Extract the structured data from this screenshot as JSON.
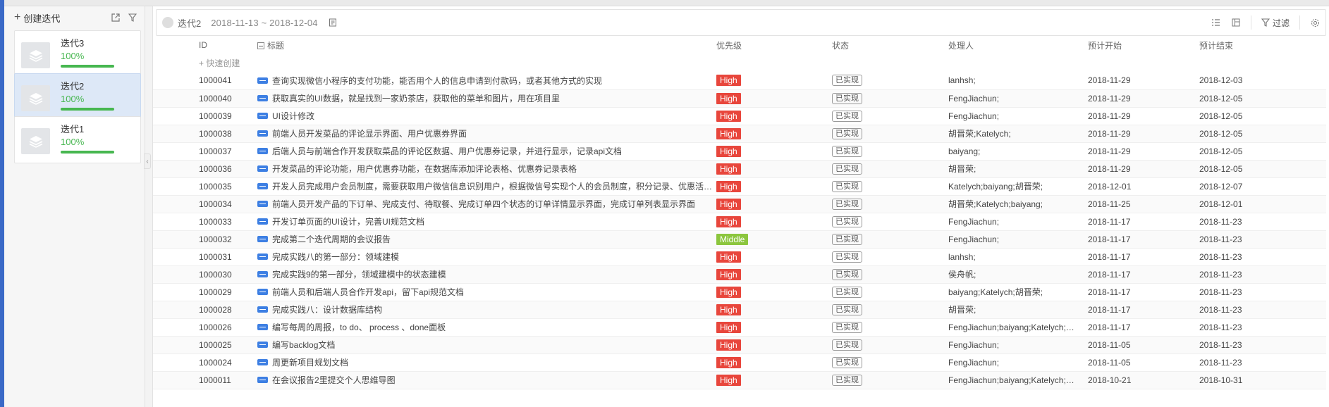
{
  "sidebar": {
    "add_label": "创建迭代",
    "iterations": [
      {
        "name": "迭代3",
        "progress_text": "100%",
        "progress": 1.0,
        "active": false
      },
      {
        "name": "迭代2",
        "progress_text": "100%",
        "progress": 1.0,
        "active": true
      },
      {
        "name": "迭代1",
        "progress_text": "100%",
        "progress": 1.0,
        "active": false
      }
    ]
  },
  "toolbar": {
    "iteration_name": "迭代2",
    "date_range": "2018-11-13 ~ 2018-12-04",
    "filter_label": "过滤"
  },
  "table": {
    "columns": {
      "id": "ID",
      "title": "标题",
      "priority": "优先级",
      "status": "状态",
      "assignee": "处理人",
      "start": "预计开始",
      "end": "预计结束"
    },
    "quick_create": "+ 快速创建",
    "rows": [
      {
        "id": "1000041",
        "title": "查询实现微信小程序的支付功能，能否用个人的信息申请到付款码，或者其他方式的实现",
        "priority": "High",
        "status": "已实现",
        "assignee": "lanhsh;",
        "start": "2018-11-29",
        "end": "2018-12-03"
      },
      {
        "id": "1000040",
        "title": "获取真实的UI数据，就是找到一家奶茶店，获取他的菜单和图片，用在项目里",
        "priority": "High",
        "status": "已实现",
        "assignee": "FengJiachun;",
        "start": "2018-11-29",
        "end": "2018-12-05"
      },
      {
        "id": "1000039",
        "title": "UI设计修改",
        "priority": "High",
        "status": "已实现",
        "assignee": "FengJiachun;",
        "start": "2018-11-29",
        "end": "2018-12-05"
      },
      {
        "id": "1000038",
        "title": "前端人员开发菜品的评论显示界面、用户优惠券界面",
        "priority": "High",
        "status": "已实现",
        "assignee": "胡晋荣;Katelych;",
        "start": "2018-11-29",
        "end": "2018-12-05"
      },
      {
        "id": "1000037",
        "title": "后端人员与前端合作开发获取菜品的评论区数据、用户优惠券记录，并进行显示，记录api文档",
        "priority": "High",
        "status": "已实现",
        "assignee": "baiyang;",
        "start": "2018-11-29",
        "end": "2018-12-05"
      },
      {
        "id": "1000036",
        "title": "开发菜品的评论功能，用户优惠券功能，在数据库添加评论表格、优惠券记录表格",
        "priority": "High",
        "status": "已实现",
        "assignee": "胡晋荣;",
        "start": "2018-11-29",
        "end": "2018-12-05"
      },
      {
        "id": "1000035",
        "title": "开发人员完成用户会员制度，需要获取用户微信信息识别用户，根据微信号实现个人的会员制度，积分记录、优惠活动…",
        "priority": "High",
        "status": "已实现",
        "assignee": "Katelych;baiyang;胡晋荣;",
        "start": "2018-12-01",
        "end": "2018-12-07"
      },
      {
        "id": "1000034",
        "title": "前端人员开发产品的下订单、完成支付、待取餐、完成订单四个状态的订单详情显示界面，完成订单列表显示界面",
        "priority": "High",
        "status": "已实现",
        "assignee": "胡晋荣;Katelych;baiyang;",
        "start": "2018-11-25",
        "end": "2018-12-01"
      },
      {
        "id": "1000033",
        "title": "开发订单页面的UI设计，完善UI规范文档",
        "priority": "High",
        "status": "已实现",
        "assignee": "FengJiachun;",
        "start": "2018-11-17",
        "end": "2018-11-23"
      },
      {
        "id": "1000032",
        "title": "完成第二个迭代周期的会议报告",
        "priority": "Middle",
        "status": "已实现",
        "assignee": "FengJiachun;",
        "start": "2018-11-17",
        "end": "2018-11-23"
      },
      {
        "id": "1000031",
        "title": "完成实践八的第一部分：领域建模",
        "priority": "High",
        "status": "已实现",
        "assignee": "lanhsh;",
        "start": "2018-11-17",
        "end": "2018-11-23"
      },
      {
        "id": "1000030",
        "title": "完成实践9的第一部分，领域建模中的状态建模",
        "priority": "High",
        "status": "已实现",
        "assignee": "侯舟帆;",
        "start": "2018-11-17",
        "end": "2018-11-23"
      },
      {
        "id": "1000029",
        "title": "前端人员和后端人员合作开发api，留下api规范文档",
        "priority": "High",
        "status": "已实现",
        "assignee": "baiyang;Katelych;胡晋荣;",
        "start": "2018-11-17",
        "end": "2018-11-23"
      },
      {
        "id": "1000028",
        "title": "完成实践八：设计数据库结构",
        "priority": "High",
        "status": "已实现",
        "assignee": "胡晋荣;",
        "start": "2018-11-17",
        "end": "2018-11-23"
      },
      {
        "id": "1000026",
        "title": "编写每周的周报，to do、 process 、done面板",
        "priority": "High",
        "status": "已实现",
        "assignee": "FengJiachun;baiyang;Katelych;…",
        "start": "2018-11-17",
        "end": "2018-11-23"
      },
      {
        "id": "1000025",
        "title": "编写backlog文档",
        "priority": "High",
        "status": "已实现",
        "assignee": "FengJiachun;",
        "start": "2018-11-05",
        "end": "2018-11-23"
      },
      {
        "id": "1000024",
        "title": "周更新项目规划文档",
        "priority": "High",
        "status": "已实现",
        "assignee": "FengJiachun;",
        "start": "2018-11-05",
        "end": "2018-11-23"
      },
      {
        "id": "1000011",
        "title": "在会议报告2里提交个人思维导图",
        "priority": "High",
        "status": "已实现",
        "assignee": "FengJiachun;baiyang;Katelych;…",
        "start": "2018-10-21",
        "end": "2018-10-31"
      }
    ]
  },
  "colors": {
    "high": "#e8463c",
    "middle": "#8cc63e",
    "progress": "#47b750",
    "active_card": "#dde8f7"
  }
}
